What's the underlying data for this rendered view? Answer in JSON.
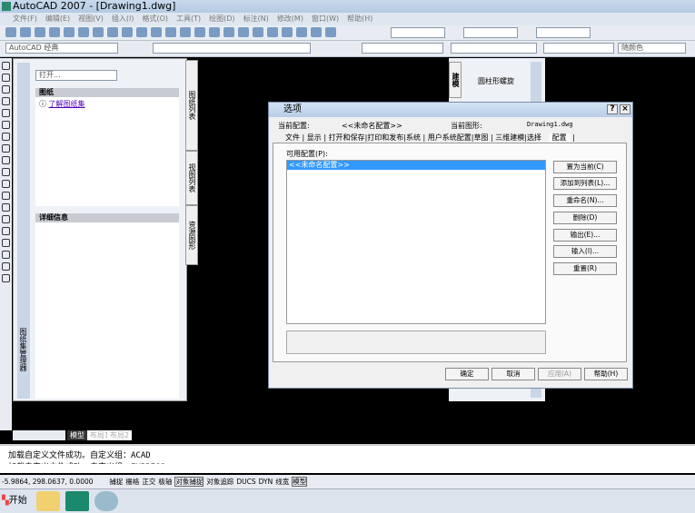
{
  "title": "AutoCAD 2007 - [Drawing1.dwg]",
  "menu": [
    "文件(F)",
    "编辑(E)",
    "视图(V)",
    "插入(I)",
    "格式(O)",
    "工具(T)",
    "绘图(D)",
    "标注(N)",
    "修改(M)",
    "窗口(W)",
    "帮助(H)"
  ],
  "workspace": "AutoCAD 经典",
  "color_combo": "随颜色",
  "sheet_palette": {
    "open_combo": "打开...",
    "sheets_header": "图纸",
    "link": "了解图纸集",
    "details_header": "详细信息",
    "side_title": "图纸集管理器",
    "tabs": [
      "图纸列表",
      "视图列表",
      "资源图形"
    ]
  },
  "tool_palette": {
    "tab": "建模",
    "item": "圆柱形螺旋"
  },
  "dialog": {
    "title": "选项",
    "current_profile_label": "当前配置:",
    "current_profile": "<<未命名配置>>",
    "current_drawing_label": "当前图形:",
    "current_drawing": "Drawing1.dwg",
    "tabs": [
      "文件",
      "显示",
      "打开和保存",
      "打印和发布",
      "系统",
      "用户系统配置",
      "草图",
      "三维建模",
      "选择",
      "配置"
    ],
    "list_label": "可用配置(P):",
    "profiles": [
      "<<未命名配置>>"
    ],
    "side_buttons": [
      "置为当前(C)",
      "添加到列表(L)...",
      "重命名(N)...",
      "删除(D)",
      "输出(E)...",
      "输入(I)...",
      "重置(R)"
    ],
    "bottom_buttons": [
      "确定",
      "取消",
      "应用(A)",
      "帮助(H)"
    ]
  },
  "layout_tabs": [
    "模型",
    "布局1",
    "布局2"
  ],
  "command_lines": [
    "加载自定义文件成功。自定义组：ACAD",
    "加载自定义文件成功。自定义组：EXPRESS"
  ],
  "coords": "-5.9864,  298.0637, 0.0000",
  "status_buttons": [
    "捕捉",
    "栅格",
    "正交",
    "极轴",
    "对象捕捉",
    "对象追踪",
    "DUCS",
    "DYN",
    "线宽",
    "模型"
  ],
  "taskbar": {
    "start": "开始"
  }
}
